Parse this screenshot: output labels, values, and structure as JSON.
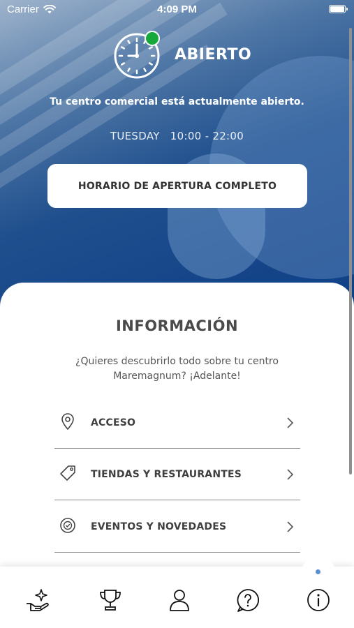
{
  "status_bar": {
    "carrier": "Carrier",
    "time": "4:09 PM"
  },
  "hero": {
    "status_label": "ABIERTO",
    "status_color": "#16a83a",
    "description": "Tu centro comercial está actualmente abierto.",
    "day": "TUESDAY",
    "hours": "10:00 - 22:00",
    "button_label": "HORARIO DE APERTURA COMPLETO"
  },
  "info": {
    "title": "INFORMACIÓN",
    "description": "¿Quieres descubrirlo todo sobre tu centro Maremagnum? ¡Adelante!",
    "items": [
      {
        "label": "ACCESO",
        "icon": "location-pin-icon"
      },
      {
        "label": "TIENDAS Y RESTAURANTES",
        "icon": "tag-icon"
      },
      {
        "label": "EVENTOS Y NOVEDADES",
        "icon": "event-badge-icon"
      }
    ]
  },
  "tab_bar": {
    "items": [
      {
        "icon": "hand-sparkle-icon"
      },
      {
        "icon": "trophy-icon"
      },
      {
        "icon": "user-icon"
      },
      {
        "icon": "help-icon"
      },
      {
        "icon": "info-icon",
        "active": true
      }
    ],
    "active_indicator_color": "#5a8fd6"
  }
}
